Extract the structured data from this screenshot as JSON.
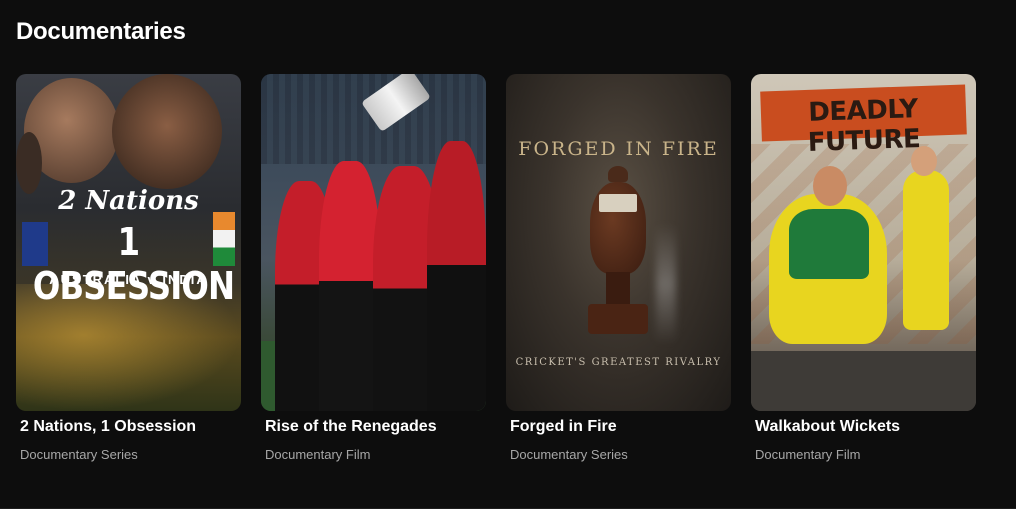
{
  "section": {
    "title": "Documentaries"
  },
  "cards": [
    {
      "title": "2 Nations, 1 Obsession",
      "subtitle": "Documentary Series",
      "poster_text": [
        "2 Nations",
        "1 OBSESSION",
        "AUSTRALIA v INDIA"
      ]
    },
    {
      "title": "Rise of the Renegades",
      "subtitle": "Documentary Film",
      "poster_text": []
    },
    {
      "title": "Forged in Fire",
      "subtitle": "Documentary Series",
      "poster_text": [
        "FORGED IN FIRE",
        "CRICKET'S GREATEST RIVALRY"
      ]
    },
    {
      "title": "Walkabout Wickets",
      "subtitle": "Documentary Film",
      "poster_text": [
        "DEADLY FUTURE"
      ]
    }
  ],
  "colors": {
    "background": "#0d0d0d",
    "subtitle": "#a7a7a7",
    "renegades_red": "#c41e2a",
    "australia_gold": "#e8d51f"
  }
}
